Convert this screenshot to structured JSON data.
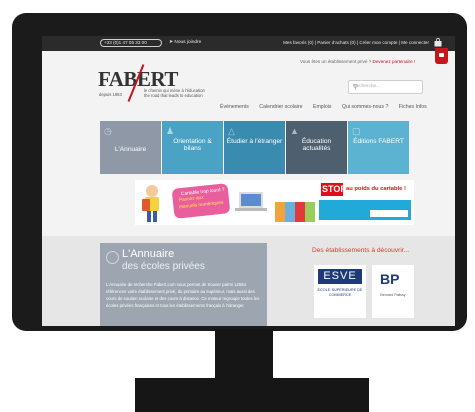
{
  "topbar": {
    "phone": "+33 (0)1 47 05 33 00",
    "contact": "Nous joindre",
    "links": "Mes favoris (0) | Panier d'achats (0) | Créer mon compte | Me connecter"
  },
  "promo": {
    "question": "Vous êtes un établissement privé ?",
    "cta": "Devenez partenaire !"
  },
  "brand": {
    "logo": "FABERT",
    "year": "depuis 1953",
    "tagline_fr": "le chemin qui mène à l'éducation",
    "tagline_en": "the road that leads to education"
  },
  "search": {
    "placeholder": "Recherche..."
  },
  "nav": {
    "items": [
      "Événements",
      "Calendrier scolaire",
      "Emplois",
      "Qui sommes-nous ?",
      "Fiches Infos"
    ]
  },
  "tiles": [
    {
      "label": "L'Annuaire",
      "icon": "clock-icon",
      "color": "#8f98a6"
    },
    {
      "label": "Orientation & bilans",
      "icon": "people-icon",
      "color": "#4aa3c4"
    },
    {
      "label": "Étudier à l'étranger",
      "icon": "graduation-icon",
      "color": "#3a8bb0"
    },
    {
      "label": "Éducation actualités",
      "icon": "megaphone-icon",
      "color": "#4e6070"
    },
    {
      "label": "Éditions FABERT",
      "icon": "book-icon",
      "color": "#5bb2d1"
    }
  ],
  "banner": {
    "line1": "Cartable trop lourd ?",
    "line2": "Passez aux",
    "line3": "manuels numériques",
    "stop": "STOP",
    "stop_rest": "au poids du cartable !"
  },
  "annuaire": {
    "title": "L'Annuaire",
    "subtitle": "des écoles privées",
    "body": "L'Annuaire de recherche Fabert.com vous permet de trouver parmi 12554 références votre établissement privé, du primaire au supérieur, mais aussi des cours de soutien scolaire et des cours à distance. Ce moteur regroupe toutes les écoles privées françaises et tous les établissements français à l'étranger."
  },
  "discover": {
    "title": "Des établissements à découvrir...",
    "esve_name": "ESVE",
    "esve_sub": "ÉCOLE SUPÉRIEURE DE COMMERCE",
    "bp_name": "BP",
    "bp_sub": "Bernard Palissy"
  }
}
